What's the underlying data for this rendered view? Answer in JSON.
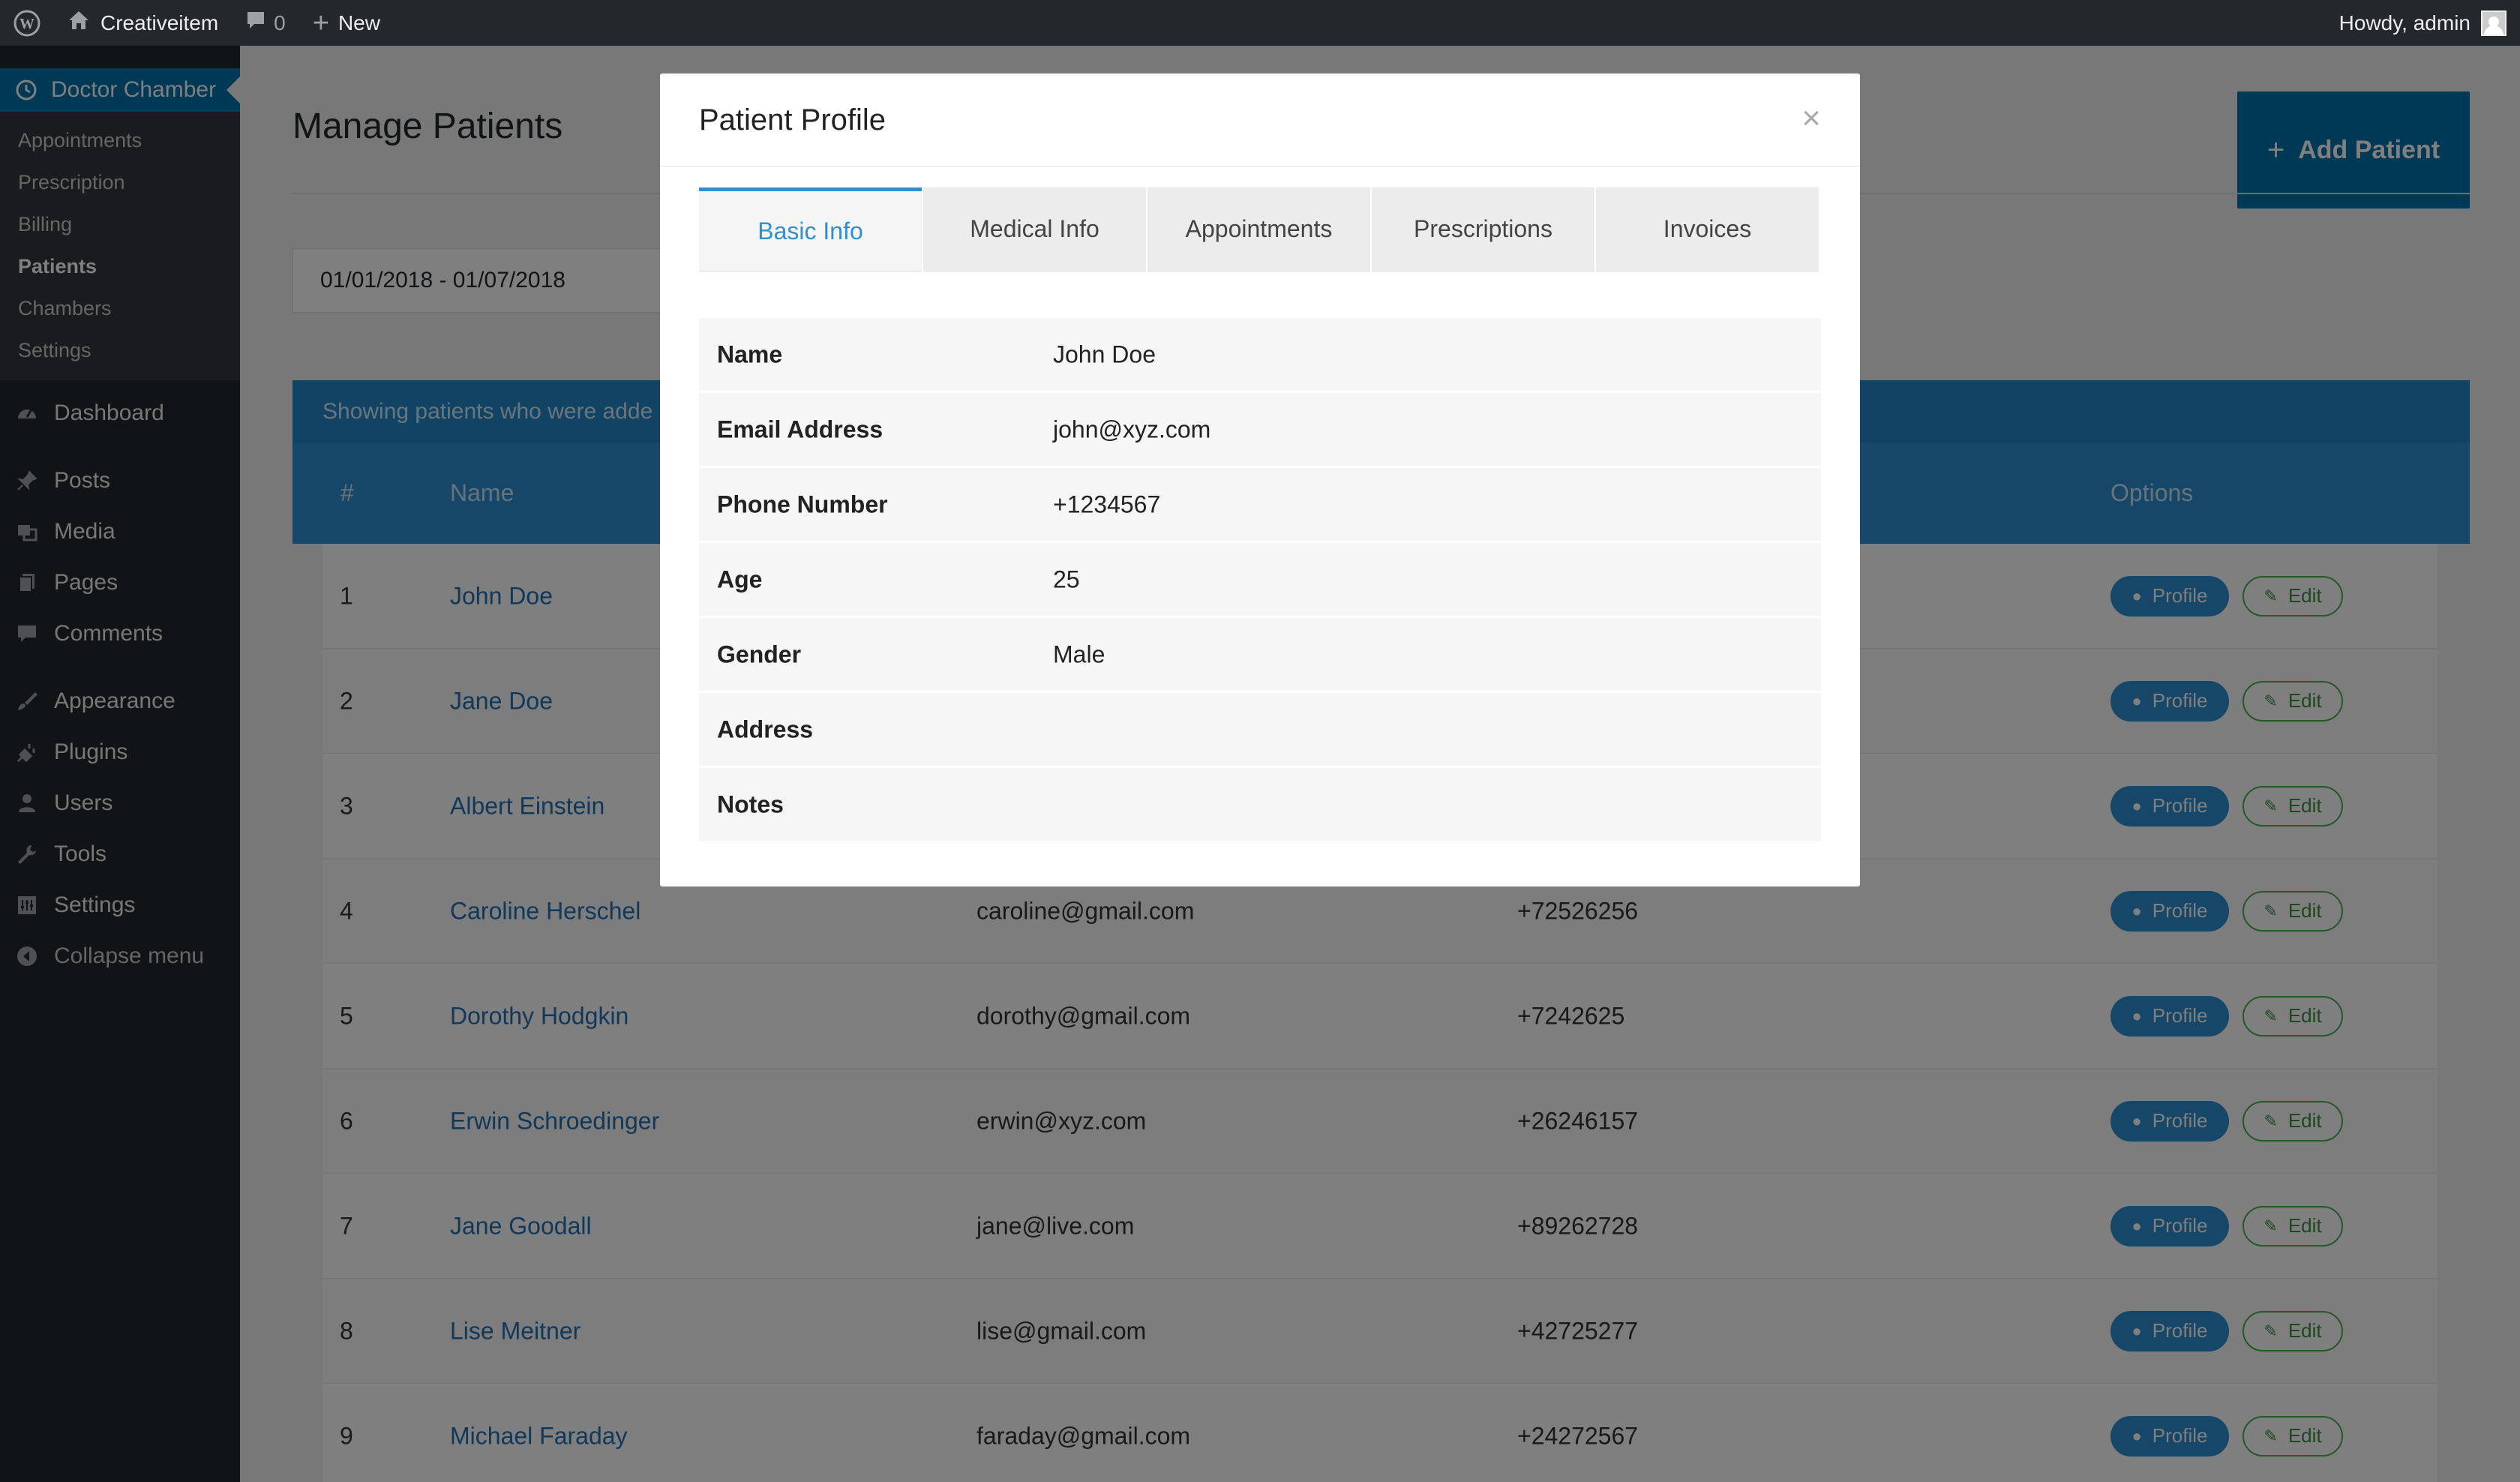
{
  "adminbar": {
    "site_name": "Creativeitem",
    "comments_count": "0",
    "new_label": "New",
    "greeting": "Howdy, admin"
  },
  "sidebar": {
    "current_menu": "Doctor Chamber",
    "submenu": [
      "Appointments",
      "Prescription",
      "Billing",
      "Patients",
      "Chambers",
      "Settings"
    ],
    "current_submenu": "Patients",
    "menu": [
      {
        "label": "Dashboard",
        "icon": "dashboard-icon"
      },
      {
        "label": "Posts",
        "icon": "pin-icon"
      },
      {
        "label": "Media",
        "icon": "media-icon"
      },
      {
        "label": "Pages",
        "icon": "pages-icon"
      },
      {
        "label": "Comments",
        "icon": "comment-icon"
      },
      {
        "label": "Appearance",
        "icon": "brush-icon"
      },
      {
        "label": "Plugins",
        "icon": "plug-icon"
      },
      {
        "label": "Users",
        "icon": "user-icon"
      },
      {
        "label": "Tools",
        "icon": "wrench-icon"
      },
      {
        "label": "Settings",
        "icon": "settings-icon"
      },
      {
        "label": "Collapse menu",
        "icon": "collapse-icon"
      }
    ]
  },
  "main": {
    "page_title": "Manage Patients",
    "add_button": "Add Patient",
    "date_range": "01/01/2018 - 01/07/2018",
    "banner_text": "Showing patients who were adde",
    "columns": {
      "num": "#",
      "name": "Name",
      "options": "Options"
    },
    "profile_label": "Profile",
    "edit_label": "Edit",
    "rows": [
      {
        "num": "1",
        "name": "John Doe",
        "email": "",
        "phone": ""
      },
      {
        "num": "2",
        "name": "Jane Doe",
        "email": "",
        "phone": ""
      },
      {
        "num": "3",
        "name": "Albert Einstein",
        "email": "",
        "phone": ""
      },
      {
        "num": "4",
        "name": "Caroline Herschel",
        "email": "caroline@gmail.com",
        "phone": "+72526256"
      },
      {
        "num": "5",
        "name": "Dorothy Hodgkin",
        "email": "dorothy@gmail.com",
        "phone": "+7242625"
      },
      {
        "num": "6",
        "name": "Erwin Schroedinger",
        "email": "erwin@xyz.com",
        "phone": "+26246157"
      },
      {
        "num": "7",
        "name": "Jane Goodall",
        "email": "jane@live.com",
        "phone": "+89262728"
      },
      {
        "num": "8",
        "name": "Lise Meitner",
        "email": "lise@gmail.com",
        "phone": "+42725277"
      },
      {
        "num": "9",
        "name": "Michael Faraday",
        "email": "faraday@gmail.com",
        "phone": "+24272567"
      }
    ]
  },
  "modal": {
    "title": "Patient Profile",
    "close": "×",
    "tabs": [
      "Basic Info",
      "Medical Info",
      "Appointments",
      "Prescriptions",
      "Invoices"
    ],
    "active_tab": "Basic Info",
    "fields": [
      {
        "label": "Name",
        "value": "John Doe"
      },
      {
        "label": "Email Address",
        "value": "john@xyz.com"
      },
      {
        "label": "Phone Number",
        "value": "+1234567"
      },
      {
        "label": "Age",
        "value": "25"
      },
      {
        "label": "Gender",
        "value": "Male"
      },
      {
        "label": "Address",
        "value": ""
      },
      {
        "label": "Notes",
        "value": ""
      }
    ]
  },
  "colors": {
    "wp_blue": "#0073aa",
    "table_blue": "#2e8fd1",
    "adminbar_bg": "#23282d",
    "edit_green": "#4caf50"
  }
}
